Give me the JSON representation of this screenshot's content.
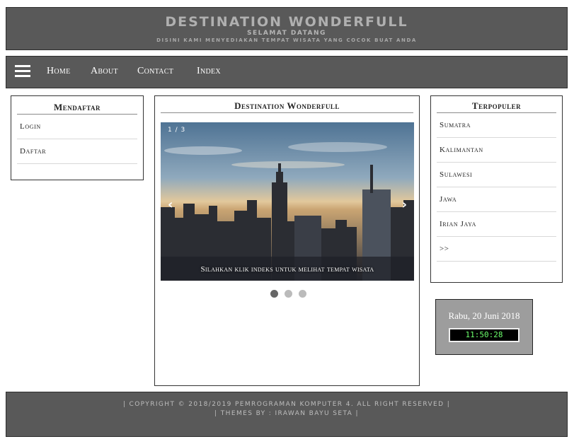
{
  "header": {
    "title": "DESTINATION WONDERFULL",
    "subtitle": "SELAMAT DATANG",
    "tagline": "DISINI KAMI MENYEDIAKAN TEMPAT WISATA YANG COCOK BUAT ANDA"
  },
  "nav": {
    "menu_icon": "hamburger-icon",
    "items": [
      "Home",
      "About",
      "Contact",
      "Index"
    ]
  },
  "left_panel": {
    "title": "Mendaftar",
    "items": [
      "Login",
      "Daftar"
    ]
  },
  "center_panel": {
    "title": "Destination Wonderfull",
    "slider": {
      "counter": "1 / 3",
      "prev_icon": "‹",
      "next_icon": "›",
      "caption": "Silahkan klik indeks untuk melihat tempat wisata",
      "total_slides": 3,
      "active_slide": 1
    }
  },
  "right_panel": {
    "title": "Terpopuler",
    "items": [
      "Sumatra",
      "Kalimantan",
      "Sulawesi",
      "Jawa",
      "Irian Jaya",
      ">>"
    ]
  },
  "clock": {
    "date": "Rabu, 20 Juni 2018",
    "time": "11:50:28"
  },
  "footer": {
    "line1": "| COPYRIGHT © 2018/2019 PEMROGRAMAN KOMPUTER 4. ALL RIGHT RESERVED |",
    "line2": "| THEMES BY : IRAWAN BAYU SETA |"
  },
  "colors": {
    "bar_background": "#595959",
    "page_background": "#ffffff",
    "clock_background": "#9d9d9d",
    "clock_digits": "#6cff6c"
  }
}
